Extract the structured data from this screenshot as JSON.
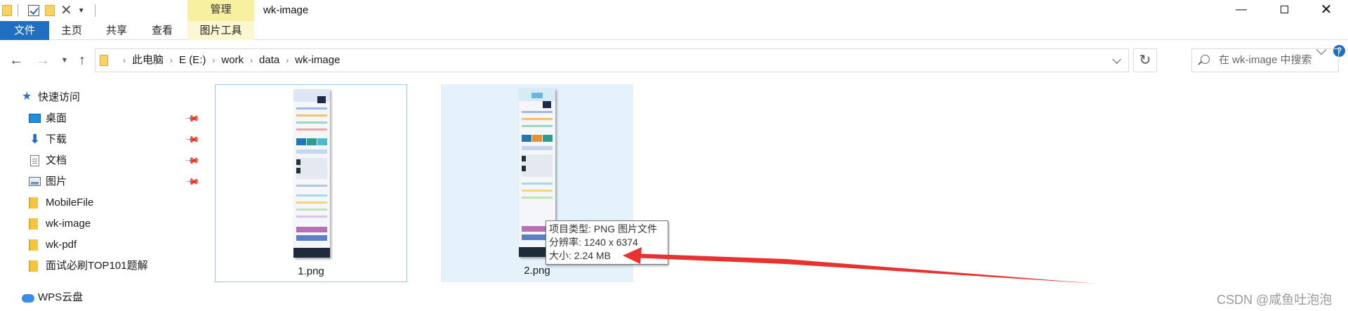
{
  "window": {
    "title": "wk-image",
    "context_tab": "管理"
  },
  "ribbon": {
    "tabs": [
      "文件",
      "主页",
      "共享",
      "查看",
      "图片工具"
    ],
    "accent": "#1e6fc1"
  },
  "address": {
    "crumbs": [
      "此电脑",
      "E (E:)",
      "work",
      "data",
      "wk-image"
    ]
  },
  "search": {
    "placeholder": "在 wk-image 中搜索"
  },
  "sidebar": {
    "quick_access": "快速访问",
    "items": [
      {
        "label": "桌面",
        "icon": "desktop-icon",
        "pinned": true
      },
      {
        "label": "下载",
        "icon": "download-icon",
        "pinned": true
      },
      {
        "label": "文档",
        "icon": "document-icon",
        "pinned": true
      },
      {
        "label": "图片",
        "icon": "pictures-icon",
        "pinned": true
      },
      {
        "label": "MobileFile",
        "icon": "folder-icon",
        "pinned": false
      },
      {
        "label": "wk-image",
        "icon": "folder-icon",
        "pinned": false
      },
      {
        "label": "wk-pdf",
        "icon": "folder-icon",
        "pinned": false
      },
      {
        "label": "面试必刷TOP101题解",
        "icon": "folder-icon",
        "pinned": false
      }
    ],
    "cloud": "WPS云盘"
  },
  "files": [
    {
      "name": "1.png",
      "state": "focused"
    },
    {
      "name": "2.png",
      "state": "hovered"
    }
  ],
  "tooltip": {
    "type_line": "项目类型: PNG 图片文件",
    "resolution_line": "分辨率: 1240 x 6374",
    "size_line": "大小: 2.24 MB"
  },
  "annotation": {
    "arrow_color": "#e8322f"
  },
  "watermark": "CSDN @咸鱼吐泡泡"
}
